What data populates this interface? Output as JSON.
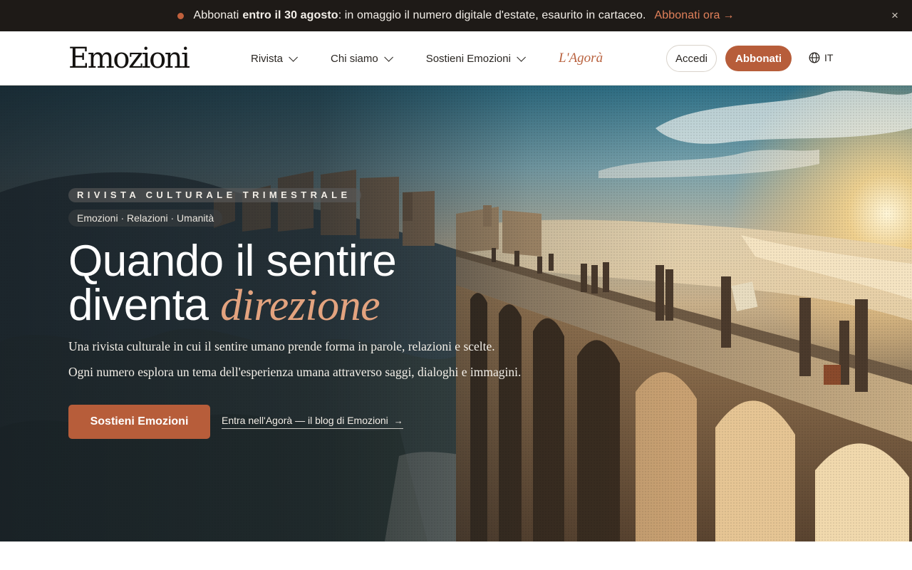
{
  "announcement": {
    "text_before": "Abbonati",
    "text_strong": "entro il 30 agosto",
    "text_after": ": in omaggio il numero digitale d'estate, esaurito in cartaceo.",
    "cta_label": "Abbonati ora",
    "cta_arrow": "→",
    "close_glyph": "×",
    "accent_color": "#c0603c"
  },
  "header": {
    "logo": "Emozioni",
    "nav": [
      {
        "label": "Rivista"
      },
      {
        "label": "Chi siamo"
      },
      {
        "label": "Sostieni Emozioni"
      }
    ],
    "agora_label": "L'Agorà",
    "login_label": "Accedi",
    "subscribe_label": "Abbonati",
    "language": "IT",
    "brand_color": "#b75d3a"
  },
  "hero": {
    "eyebrow": "RIVISTA CULTURALE TRIMESTRALE",
    "tags": "Emozioni · Relazioni · Umanità",
    "headline_line1": "Quando il sentire",
    "headline_line2_plain": "diventa ",
    "headline_line2_accent": "direzione",
    "subtitle1": "Una rivista culturale in cui il sentire umano prende forma in parole, relazioni e scelte.",
    "subtitle2": "Ogni numero esplora un tema dell'esperienza umana attraverso saggi, dialoghi e immagini.",
    "primary_cta": "Sostieni Emozioni",
    "secondary_cta": "Entra nell'Agorà — il blog di Emozioni",
    "secondary_arrow": "→",
    "accent_color": "#e3a37f"
  }
}
